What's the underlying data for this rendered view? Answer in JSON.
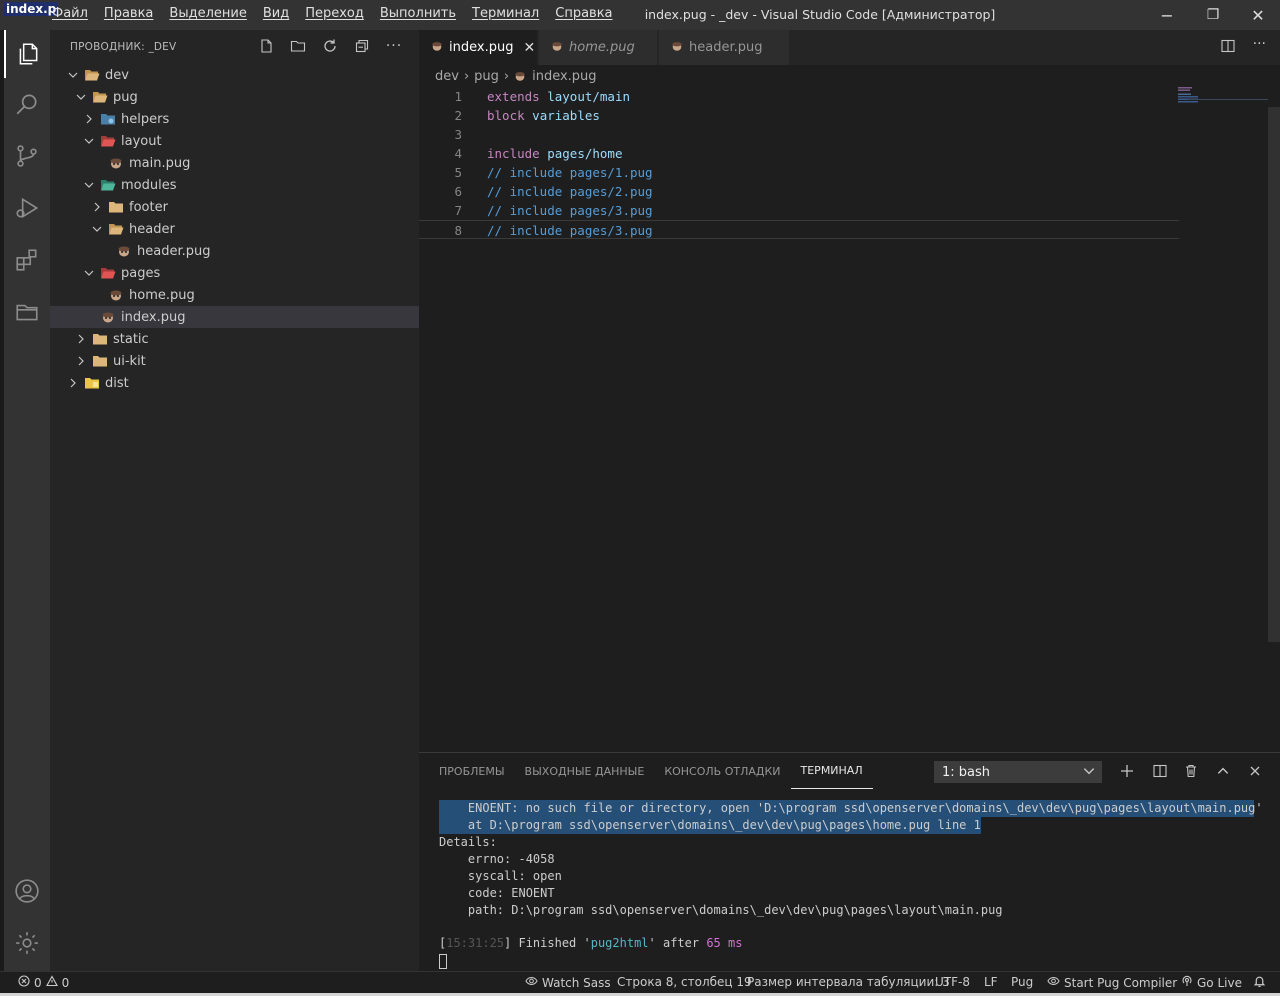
{
  "titlebar": {
    "app_tab": "index.p",
    "menu": [
      "Файл",
      "Правка",
      "Выделение",
      "Вид",
      "Переход",
      "Выполнить",
      "Терминал",
      "Справка"
    ],
    "window_title": "index.pug - _dev - Visual Studio Code [Администратор]",
    "minimize": "−",
    "restore": "❐",
    "close": "✕"
  },
  "sidebar": {
    "title": "ПРОВОДНИК: _DEV",
    "tree": [
      {
        "label": "dev",
        "icon": "folder-open",
        "chevron": "down"
      },
      {
        "label": "pug",
        "icon": "folder-open",
        "chevron": "down"
      },
      {
        "label": "helpers",
        "icon": "folder-helpers",
        "chevron": "right"
      },
      {
        "label": "layout",
        "icon": "folder-layout-open",
        "chevron": "down"
      },
      {
        "label": "main.pug",
        "icon": "pug-file",
        "chevron": ""
      },
      {
        "label": "modules",
        "icon": "folder-modules-open",
        "chevron": "down"
      },
      {
        "label": "footer",
        "icon": "folder",
        "chevron": "right"
      },
      {
        "label": "header",
        "icon": "folder-open",
        "chevron": "down"
      },
      {
        "label": "header.pug",
        "icon": "pug-file",
        "chevron": ""
      },
      {
        "label": "pages",
        "icon": "folder-pages-open",
        "chevron": "down"
      },
      {
        "label": "home.pug",
        "icon": "pug-file",
        "chevron": ""
      },
      {
        "label": "index.pug",
        "icon": "pug-file",
        "chevron": ""
      },
      {
        "label": "static",
        "icon": "folder",
        "chevron": "right"
      },
      {
        "label": "ui-kit",
        "icon": "folder",
        "chevron": "right"
      },
      {
        "label": "dist",
        "icon": "folder-dist",
        "chevron": "right"
      }
    ]
  },
  "tabs": [
    {
      "label": "index.pug",
      "active": true,
      "close": "✕"
    },
    {
      "label": "home.pug",
      "active": false
    },
    {
      "label": "header.pug",
      "active": false
    }
  ],
  "breadcrumb": [
    "dev",
    "pug",
    "index.pug"
  ],
  "editor": {
    "lines": [
      {
        "n": "1",
        "tokens": [
          [
            "kw",
            "extends"
          ],
          [
            "",
            " "
          ],
          [
            "id",
            "layout/main"
          ]
        ]
      },
      {
        "n": "2",
        "tokens": [
          [
            "kw",
            "block"
          ],
          [
            "",
            " "
          ],
          [
            "id",
            "variables"
          ]
        ]
      },
      {
        "n": "3",
        "tokens": []
      },
      {
        "n": "4",
        "tokens": [
          [
            "kw",
            "include"
          ],
          [
            "",
            " "
          ],
          [
            "id",
            "pages/home"
          ]
        ]
      },
      {
        "n": "5",
        "tokens": [
          [
            "cm",
            "// include pages/1.pug"
          ]
        ]
      },
      {
        "n": "6",
        "tokens": [
          [
            "cm",
            "// include pages/2.pug"
          ]
        ]
      },
      {
        "n": "7",
        "tokens": [
          [
            "cm",
            "// include pages/3.pug"
          ]
        ]
      },
      {
        "n": "8",
        "tokens": [
          [
            "cm",
            "// include pages/3.pug"
          ]
        ]
      }
    ]
  },
  "panel": {
    "tabs": [
      "ПРОБЛЕМЫ",
      "ВЫХОДНЫЕ ДАННЫЕ",
      "КОНСОЛЬ ОТЛАДКИ",
      "ТЕРМИНАЛ"
    ],
    "active_tab": "ТЕРМИНАЛ",
    "terminal_select": "1: bash",
    "terminal": {
      "err1": "    ENOENT: no such file or directory, open 'D:\\program ssd\\openserver\\domains\\_dev\\dev\\pug\\pages\\layout\\main.pug'",
      "err2": "    at D:\\program ssd\\openserver\\domains\\_dev\\dev\\pug\\pages\\home.pug line 1",
      "details": "Details:",
      "errno": "    errno: -4058",
      "syscall": "    syscall: open",
      "code": "    code: ENOENT",
      "path": "    path: D:\\program ssd\\openserver\\domains\\_dev\\dev\\pug\\pages\\layout\\main.pug",
      "time": "15:31:25",
      "finished": "] Finished '",
      "task": "pug2html",
      "after": "' after ",
      "ms": "65 ms"
    }
  },
  "statusbar": {
    "errors": "0",
    "warnings": "0",
    "watch_sass": "Watch Sass",
    "position": "Строка 8, столбец 19",
    "tab_size": "Размер интервала табуляции: 3",
    "encoding": "UTF-8",
    "eol": "LF",
    "language": "Pug",
    "pug_compiler": "Start Pug Compiler",
    "go_live": "Go Live"
  }
}
